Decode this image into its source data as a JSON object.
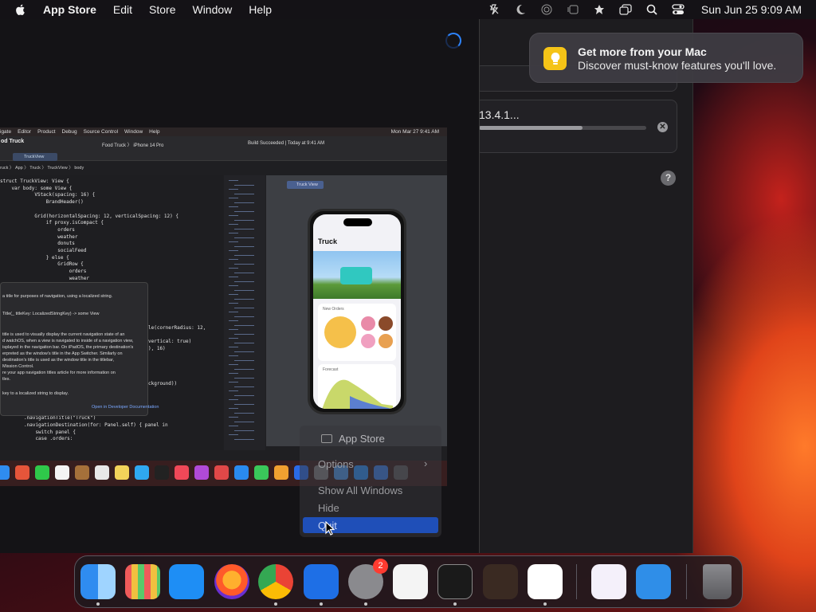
{
  "menubar": {
    "app_name": "App Store",
    "items": [
      "Edit",
      "Store",
      "Window",
      "Help"
    ],
    "clock": "Sun Jun 25  9:09 AM",
    "status_icons": [
      "battery-icon",
      "moon-icon",
      "airdrop-icon",
      "stage-manager-icon",
      "location-icon",
      "screen-mirroring-icon",
      "search-icon",
      "control-center-icon"
    ]
  },
  "notification": {
    "title": "Get more from your Mac",
    "body": "Discover must-know features you'll love."
  },
  "download": {
    "name": "13.4.1...",
    "progress": 0.62
  },
  "xcode_screenshot": {
    "menu": [
      "igate",
      "Editor",
      "Product",
      "Debug",
      "Source Control",
      "Window",
      "Help"
    ],
    "menu_clock": "Mon Mar 27  9:41 AM",
    "title": "od Truck",
    "scheme": "Food Truck  〉 iPhone 14 Pro",
    "build_status": "Build Succeeded | Today at 9:41 AM",
    "tab": "TruckView",
    "breadcrumb": "ruck 〉 App 〉 Truck 〉 TruckView 〉 body",
    "code": [
      "struct TruckView: View {",
      "    var body: some View {",
      "            VStack(spacing: 16) {",
      "                BrandHeader()",
      "",
      "            Grid(horizontalSpacing: 12, verticalSpacing: 12) {",
      "                if proxy.isCompact {",
      "                    orders",
      "                    weather",
      "                    donuts",
      "                    socialFeed",
      "                } else {",
      "                    GridRow {",
      "                        orders",
      "                        weather"
    ],
    "code_tail": [
      "le(cornerRadius: 12,",
      "",
      "vertical: true)",
      "), 16)",
      "",
      "",
      "",
      "",
      "ckground))",
      "",
      "",
      "",
      ".background()",
      ".navigationTitle(\"Truck\")",
      ".navigationDestination(for: Panel.self) { panel in",
      "    switch panel {",
      "    case .orders:"
    ],
    "popover_lines": [
      "a title for purposes of navigation, using a localized string.",
      "Title(_ titleKey: LocalizedStringKey) -> some View",
      "title is used to visually display the current navigation state of an",
      "d watchOS, when a view is navigated to inside of a navigation view,",
      "isplayed in the navigation bar. On iPadOS, the primary destination's",
      "erpreted as the window's title in the App Switcher. Similarly on",
      "destination's title is used as the window title in the titlebar,",
      "Mission Control.",
      "re your app navigation titles article for more information on",
      "tles.",
      "key to a localized string to display.",
      "Open in Developer Documentation"
    ],
    "preview_tab": "Truck View",
    "phone_title": "Truck",
    "card1_label": "New Orders",
    "card2_label": "Forecast"
  },
  "context_menu": {
    "app_name": "App Store",
    "items": [
      "Options",
      "Show All Windows",
      "Hide",
      "Quit"
    ],
    "selected": "Quit"
  },
  "dock": {
    "apps": [
      {
        "name": "Finder",
        "color": "#2f8cf0",
        "running": true
      },
      {
        "name": "Launchpad",
        "color": "#d8d8dc",
        "running": false
      },
      {
        "name": "Safari",
        "color": "#1e8ef5",
        "running": false
      },
      {
        "name": "Firefox",
        "color": "#6a2fd0",
        "running": false
      },
      {
        "name": "Chrome",
        "color": "#f0f0f0",
        "running": true
      },
      {
        "name": "App Store",
        "color": "#1e6fe6",
        "running": true
      },
      {
        "name": "System Settings",
        "color": "#8a8a8e",
        "running": true,
        "badge": "2"
      },
      {
        "name": "TextEdit",
        "color": "#f4f4f4",
        "running": false
      },
      {
        "name": "Terminal",
        "color": "#1a1a1a",
        "running": true
      },
      {
        "name": "GarageBand",
        "color": "#3a2a22",
        "running": false
      },
      {
        "name": "Visual Studio Code",
        "color": "#ffffff",
        "running": true
      },
      {
        "name": "Visual Studio",
        "color": "#f4f0fa",
        "running": false
      },
      {
        "name": "Weather",
        "color": "#2f8ee8",
        "running": false
      },
      {
        "name": "Trash",
        "color": "#2a2a2e",
        "running": false
      }
    ]
  }
}
